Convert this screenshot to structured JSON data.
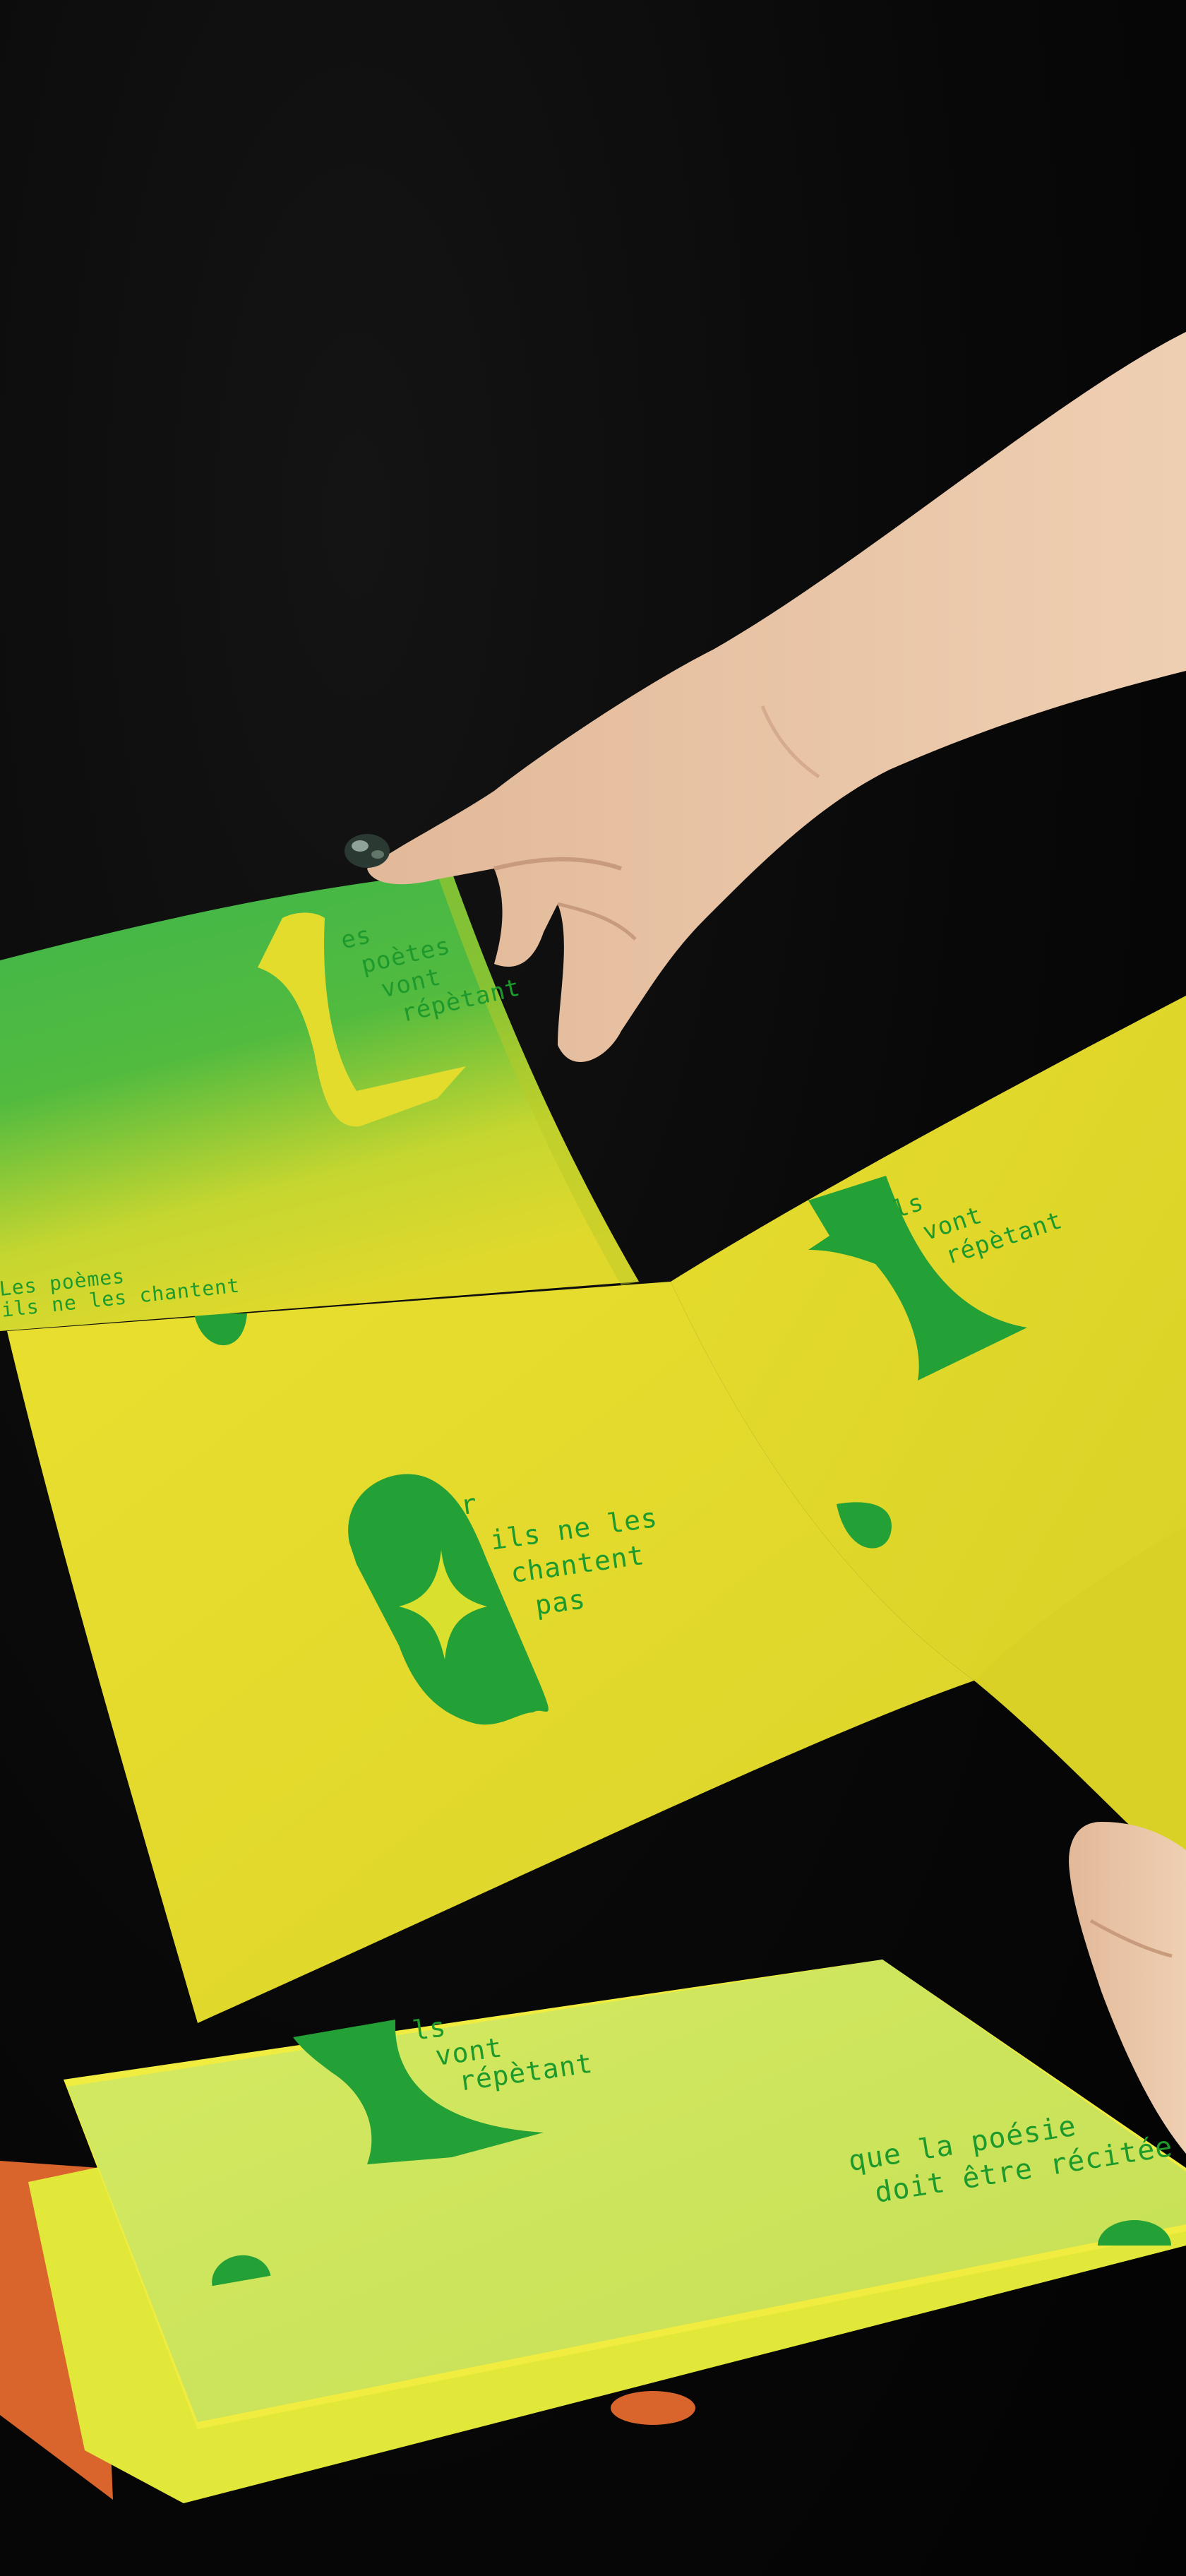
{
  "colors": {
    "background": "#050505",
    "paper_yellow": "#e3db2a",
    "paper_lime": "#cde65a",
    "ink_green": "#23a036",
    "gradient_green": "#3fb54a",
    "skin": "#e8c4a4",
    "ring": "#2a3a33",
    "accent_orange": "#d9652c"
  },
  "icons": {
    "sparkle": "four-point-star-icon",
    "dot": "half-circle-dot-icon",
    "ring": "ring-icon"
  },
  "top_page": {
    "letter": "L",
    "lines": [
      "es",
      "poètes",
      "vont",
      "répètant"
    ],
    "footer_lines": [
      "Les poèmes",
      "ils ne les chantent"
    ]
  },
  "right_page": {
    "letter": "I",
    "lines": [
      "ls",
      "vont",
      "répètant"
    ]
  },
  "center_page": {
    "letter": "O",
    "lines": [
      "r",
      "ils ne les",
      "chantent",
      "pas"
    ]
  },
  "bottom_booklet": {
    "letter": "I",
    "lines": [
      "ls",
      "vont",
      "répètant"
    ],
    "footer_lines": [
      "que la poésie",
      "doit être récitée"
    ]
  }
}
